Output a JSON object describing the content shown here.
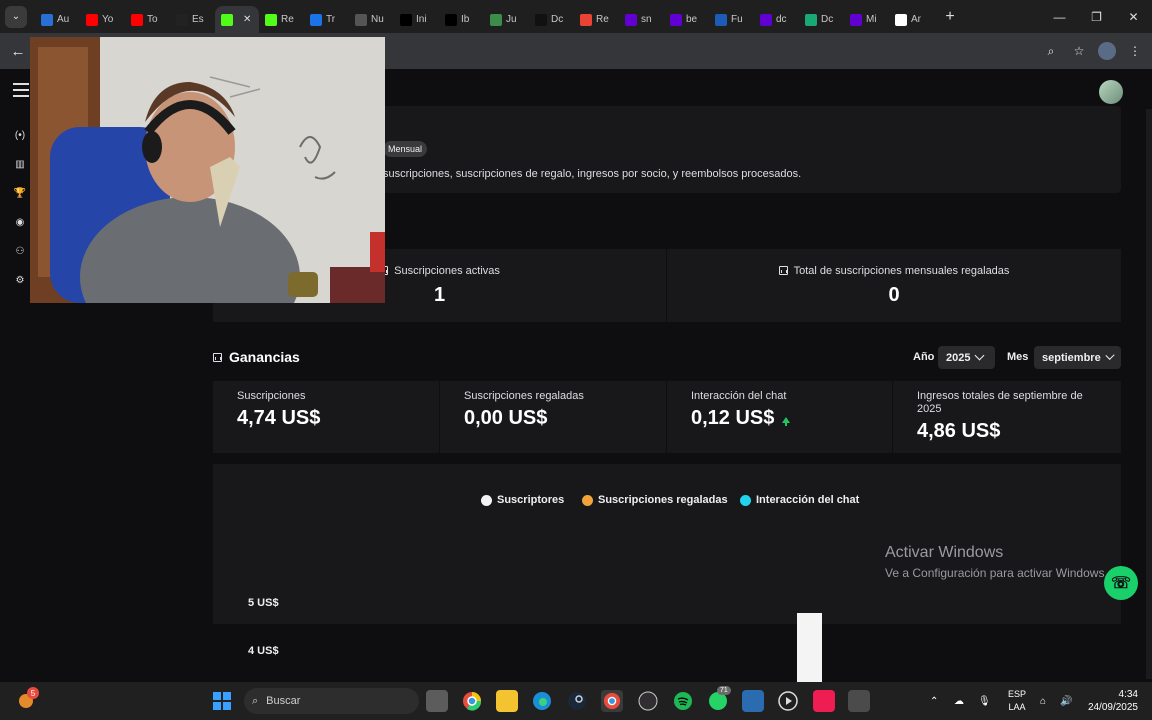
{
  "browser": {
    "tabs": [
      {
        "label": "Au",
        "icon": "globe-icon",
        "color": "#2a6fd6"
      },
      {
        "label": "Yo",
        "icon": "youtube-icon",
        "color": "#ff0000"
      },
      {
        "label": "To",
        "icon": "youtube-icon",
        "color": "#ff0000"
      },
      {
        "label": "Es",
        "icon": "dark-icon",
        "color": "#222222"
      },
      {
        "label": "",
        "icon": "kick-icon",
        "color": "#53fc18"
      },
      {
        "label": "Re",
        "icon": "kick-icon",
        "color": "#53fc18"
      },
      {
        "label": "Tr",
        "icon": "translate-icon",
        "color": "#1a73e8"
      },
      {
        "label": "Nu",
        "icon": "globe-icon",
        "color": "#555555"
      },
      {
        "label": "Ini",
        "icon": "x-icon",
        "color": "#000000"
      },
      {
        "label": "Ib",
        "icon": "x-icon",
        "color": "#000000"
      },
      {
        "label": "Ju",
        "icon": "person-icon",
        "color": "#3c8c4a"
      },
      {
        "label": "Dc",
        "icon": "tiktok-icon",
        "color": "#111111"
      },
      {
        "label": "Re",
        "icon": "gmail-icon",
        "color": "#ea4335"
      },
      {
        "label": "sn",
        "icon": "yahoo-icon",
        "color": "#6001d2"
      },
      {
        "label": "be",
        "icon": "yahoo-icon",
        "color": "#6001d2"
      },
      {
        "label": "Fu",
        "icon": "edge-icon",
        "color": "#1e5bb5"
      },
      {
        "label": "dc",
        "icon": "yahoo-icon",
        "color": "#6001d2"
      },
      {
        "label": "Dc",
        "icon": "copilot-icon",
        "color": "#19a974"
      },
      {
        "label": "Mi",
        "icon": "yahoo-icon",
        "color": "#6001d2"
      },
      {
        "label": "Ar",
        "icon": "wikipedia-icon",
        "color": "#ffffff"
      }
    ],
    "active_tab": 4,
    "new_tab": "+",
    "minimize": "—",
    "maximize": "❐",
    "close": "✕"
  },
  "header": {
    "badge": "Mensual",
    "description": "suscripciones, suscripciones de regalo, ingresos por socio, y reembolsos procesados."
  },
  "subs": {
    "active_label": "Suscripciones activas",
    "active_value": "1",
    "gifted_label": "Total de suscripciones mensuales regaladas",
    "gifted_value": "0"
  },
  "ganancias": {
    "title": "Ganancias",
    "year_label": "Año",
    "year_value": "2025",
    "month_label": "Mes",
    "month_value": "septiembre",
    "cards": [
      {
        "label": "Suscripciones",
        "value": "4,74 US$"
      },
      {
        "label": "Suscripciones regaladas",
        "value": "0,00 US$"
      },
      {
        "label": "Interacción del chat",
        "value": "0,12 US$"
      },
      {
        "label": "Ingresos totales de septiembre de 2025",
        "value": "4,86 US$"
      }
    ]
  },
  "chart_data": {
    "type": "bar",
    "series": [
      {
        "name": "Suscriptores",
        "color": "#f4f4f4"
      },
      {
        "name": "Suscripciones regaladas",
        "color": "#f0a43a"
      },
      {
        "name": "Interacción del chat",
        "color": "#22d3ee"
      }
    ],
    "yticks": [
      "5 US$",
      "4 US$"
    ]
  },
  "watermark": {
    "line1": "Activar Windows",
    "line2": "Ve a Configuración para activar Windows."
  },
  "taskbar": {
    "search_placeholder": "Buscar",
    "notif_count": "5",
    "whatsapp_badge": "71",
    "lang_line1": "ESP",
    "lang_line2": "LAA",
    "time": "4:34",
    "date": "24/09/2025"
  }
}
